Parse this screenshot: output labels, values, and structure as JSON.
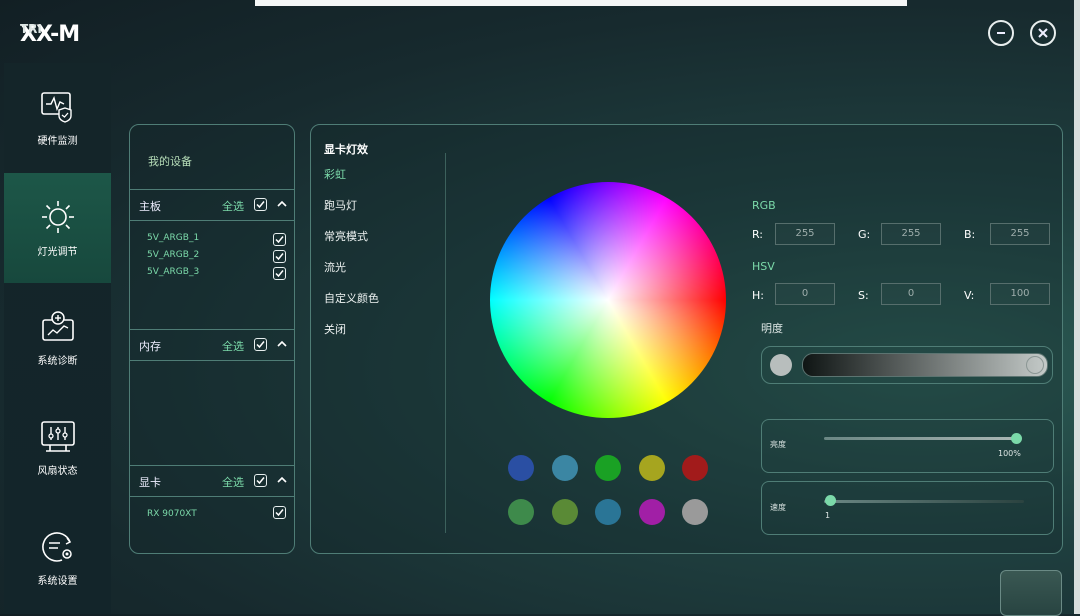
{
  "app": {
    "logo_text": "TRIXX-M"
  },
  "sidebar": {
    "items": [
      {
        "label": "硬件监测",
        "icon": "hardware-monitor-icon"
      },
      {
        "label": "灯光调节",
        "icon": "sun-icon"
      },
      {
        "label": "系统诊断",
        "icon": "diagnosis-icon"
      },
      {
        "label": "风扇状态",
        "icon": "fan-control-icon"
      },
      {
        "label": "系统设置",
        "icon": "settings-icon"
      }
    ],
    "active": 1
  },
  "devices": {
    "title": "我的设备",
    "sections": [
      {
        "label": "主板",
        "select_all": "全选",
        "items": [
          "5V_ARGB_1",
          "5V_ARGB_2",
          "5V_ARGB_3"
        ]
      },
      {
        "label": "内存",
        "select_all": "全选",
        "items": []
      },
      {
        "label": "显卡",
        "select_all": "全选",
        "items": [
          "RX 9070XT"
        ]
      }
    ]
  },
  "effects": {
    "title": "显卡灯效",
    "items": [
      "彩虹",
      "跑马灯",
      "常亮模式",
      "流光",
      "自定义颜色",
      "关闭"
    ],
    "active": 0
  },
  "color": {
    "rgb_label": "RGB",
    "hsv_label": "HSV",
    "r_label": "R:",
    "g_label": "G:",
    "b_label": "B:",
    "h_label": "H:",
    "s_label": "S:",
    "v_label": "V:",
    "r": "255",
    "g": "255",
    "b": "255",
    "h": "0",
    "s": "0",
    "v": "100",
    "brightness_label": "明度",
    "presets": [
      "#2a4fa3",
      "#3b86a3",
      "#1aa124",
      "#a6a51f",
      "#a21b1b",
      "#3e8a4b",
      "#5a8a36",
      "#2a7596",
      "#a11fa6",
      "#9a9a9a"
    ]
  },
  "sliders": {
    "brightness_label": "亮度",
    "brightness_value": "100%",
    "brightness_level": 100,
    "speed_label": "速度",
    "speed_value": "1",
    "speed_level": 0
  }
}
